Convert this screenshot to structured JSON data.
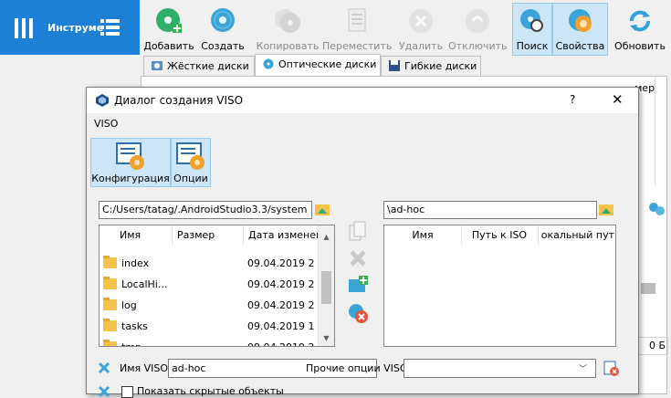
{
  "app": {
    "tools_label": "Инструме",
    "toolbar": {
      "add": "Добавить",
      "create": "Создать",
      "copy": "Копировать",
      "move": "Переместить",
      "remove": "Удалить",
      "release": "Отключить",
      "search": "Поиск",
      "properties": "Свойства",
      "refresh": "Обновить"
    },
    "tabs": [
      "Жёсткие диски",
      "Оптические диски",
      "Гибкие диски"
    ],
    "right_fragments": {
      "col": "мер",
      "size": "0 Б"
    }
  },
  "dialog": {
    "title": "Диалог создания VISO",
    "help": "?",
    "close": "✕",
    "menu": "VISO",
    "modes": {
      "config": "Конфигурация",
      "options": "Опции"
    },
    "host": {
      "path": "C:/Users/tatag/.AndroidStudio3.3/system",
      "columns": [
        "Имя",
        "Размер",
        "Дата изменен"
      ],
      "rows": [
        {
          "name": "index",
          "size": "",
          "date": "09.04.2019 2"
        },
        {
          "name": "LocalHi...",
          "size": "",
          "date": "09.04.2019 2"
        },
        {
          "name": "log",
          "size": "",
          "date": "09.04.2019 2"
        },
        {
          "name": "tasks",
          "size": "",
          "date": "09.04.2019 1"
        },
        {
          "name": "tmp",
          "size": "",
          "date": "09.04.2019 2"
        }
      ]
    },
    "viso": {
      "path": "\\ad-hoc",
      "columns": [
        "Имя",
        "Путь к ISO",
        "окальный пут"
      ]
    },
    "fields": {
      "viso_name_label": "Имя VISO:",
      "viso_name_value": "ad-hoc",
      "custom_options_label": "Прочие опции VISO:",
      "custom_options_value": "",
      "checkbox_label": "Показать скрытые объекты"
    }
  }
}
